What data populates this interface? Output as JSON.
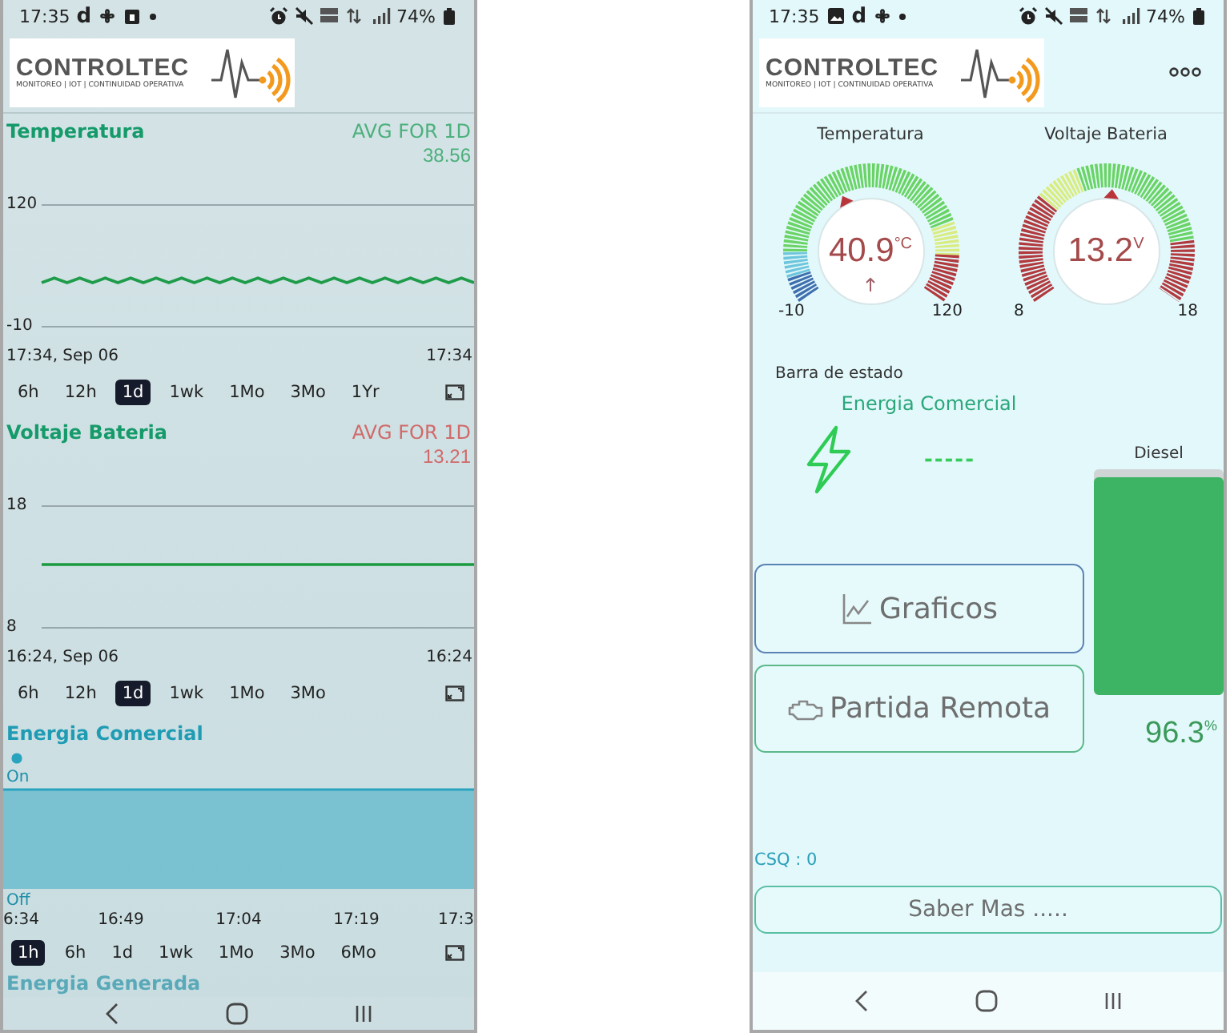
{
  "left_screen": {
    "status_bar": {
      "time": "17:35",
      "app_mark": "d",
      "battery": "74%"
    },
    "logo": {
      "name": "CONTROLTEC",
      "tagline": "MONITOREO | IOT | CONTINUIDAD OPERATIVA"
    },
    "panels": [
      {
        "kind": "line",
        "title": "Temperatura",
        "avg": {
          "label": "AVG FOR 1D",
          "value": "38.56",
          "color": "#4cb07c"
        },
        "start_time": "17:34, Sep 06",
        "end_time": "17:34",
        "chart_data": {
          "type": "line",
          "ylim": [
            -10,
            120
          ],
          "yticks": [
            -10,
            120
          ],
          "series": [
            {
              "color": "#1e9c4a",
              "values": [
                37,
                42,
                37,
                42,
                37,
                42,
                37,
                42,
                37,
                42,
                37,
                42,
                37,
                42,
                37,
                42,
                37,
                42,
                37,
                42,
                37,
                42,
                37,
                42,
                37,
                42,
                37,
                42,
                37,
                42,
                37,
                42,
                37,
                42,
                37
              ]
            }
          ]
        },
        "ranges": [
          {
            "label": "6h",
            "selected": false
          },
          {
            "label": "12h",
            "selected": false
          },
          {
            "label": "1d",
            "selected": true
          },
          {
            "label": "1wk",
            "selected": false
          },
          {
            "label": "1Mo",
            "selected": false
          },
          {
            "label": "3Mo",
            "selected": false
          },
          {
            "label": "1Yr",
            "selected": false
          }
        ]
      },
      {
        "kind": "line",
        "title": "Voltaje Bateria",
        "avg": {
          "label": "AVG FOR 1D",
          "value": "13.21",
          "color": "#d06a6a"
        },
        "start_time": "16:24, Sep 06",
        "end_time": "16:24",
        "chart_data": {
          "type": "line",
          "ylim": [
            8,
            18
          ],
          "yticks": [
            8,
            18
          ],
          "series": [
            {
              "color": "#1a9a3e",
              "values": [
                13.2,
                13.2,
                13.2,
                13.2,
                13.2,
                13.2,
                13.2,
                13.2
              ]
            }
          ]
        },
        "ranges": [
          {
            "label": "6h",
            "selected": false
          },
          {
            "label": "12h",
            "selected": false
          },
          {
            "label": "1d",
            "selected": true
          },
          {
            "label": "1wk",
            "selected": false
          },
          {
            "label": "1Mo",
            "selected": false
          },
          {
            "label": "3Mo",
            "selected": false
          }
        ]
      },
      {
        "kind": "state",
        "title": "Energia Comercial",
        "on_label": "On",
        "off_label": "Off",
        "color": "#2aa3bf",
        "x_labels": [
          "6:34",
          "16:49",
          "17:04",
          "17:19",
          "17:3"
        ],
        "ranges": [
          {
            "label": "1h",
            "selected": true
          },
          {
            "label": "6h",
            "selected": false
          },
          {
            "label": "1d",
            "selected": false
          },
          {
            "label": "1wk",
            "selected": false
          },
          {
            "label": "1Mo",
            "selected": false
          },
          {
            "label": "3Mo",
            "selected": false
          },
          {
            "label": "6Mo",
            "selected": false
          }
        ]
      }
    ],
    "faded_title": "Energia Generada"
  },
  "right_screen": {
    "status_bar": {
      "time": "17:35",
      "app_mark": "d",
      "battery": "74%"
    },
    "logo": {
      "name": "CONTROLTEC",
      "tagline": "MONITOREO | IOT | CONTINUIDAD OPERATIVA"
    },
    "gauges": [
      {
        "kind": "temperature",
        "title": "Temperatura",
        "reading": "40.9$^{°C}$",
        "level": 0.39,
        "min": "-10",
        "max": "120",
        "trend_up": true
      },
      {
        "kind": "voltage",
        "title": "Voltaje Bateria",
        "reading": "13.2$^{V}$",
        "level": 0.52,
        "min": "8",
        "max": "18"
      }
    ],
    "status_section": {
      "label": "Barra de estado",
      "title": "Energia Comercial",
      "value": "-----"
    },
    "tank": {
      "label": "Diesel",
      "level": 0.963,
      "reading": "96.3$^{%}$"
    },
    "buttons": [
      {
        "kind": "chart",
        "label": "Graficos",
        "color": "#5b82b5"
      },
      {
        "kind": "engine",
        "label": "Partida Remota",
        "color": "#5cb88a"
      }
    ],
    "signal": "CSQ : 0",
    "more_button": {
      "label": "Saber Mas ....."
    }
  }
}
